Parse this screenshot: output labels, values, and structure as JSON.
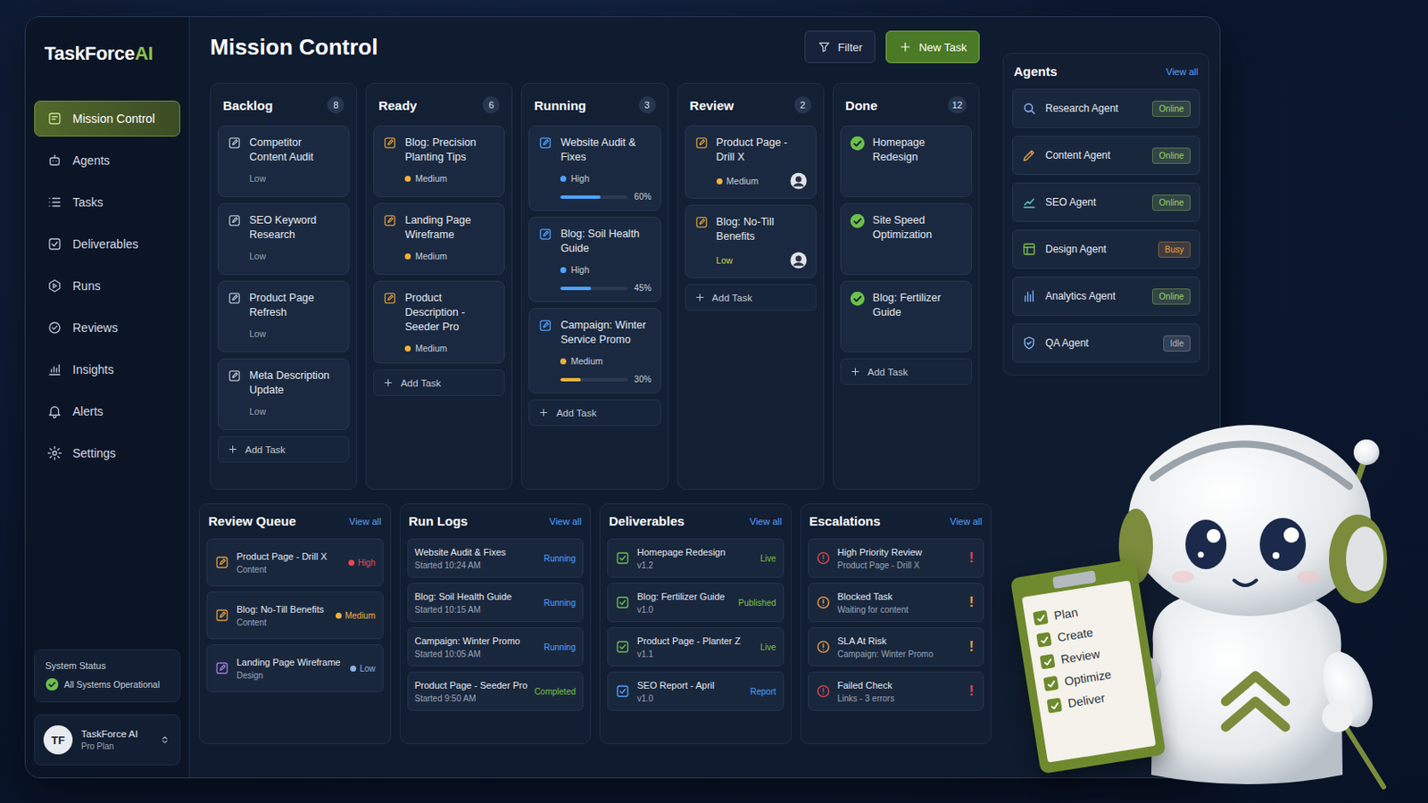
{
  "brand": {
    "name": "TaskForce",
    "accent": "AI"
  },
  "sidebar": {
    "items": [
      {
        "label": "Mission Control",
        "selected": true
      },
      {
        "label": "Agents",
        "selected": false
      },
      {
        "label": "Tasks",
        "selected": false
      },
      {
        "label": "Deliverables",
        "selected": false
      },
      {
        "label": "Runs",
        "selected": false
      },
      {
        "label": "Reviews",
        "selected": false
      },
      {
        "label": "Insights",
        "selected": false
      },
      {
        "label": "Alerts",
        "selected": false
      },
      {
        "label": "Settings",
        "selected": false
      }
    ]
  },
  "system_status": {
    "title": "System Status",
    "message": "All Systems Operational",
    "ok": true
  },
  "user": {
    "initials": "TF",
    "name": "TaskForce AI",
    "plan": "Pro Plan"
  },
  "header": {
    "title": "Mission Control",
    "buttons": [
      {
        "label": "Filter",
        "kind": "secondary"
      },
      {
        "label": "New Task",
        "kind": "primary"
      }
    ]
  },
  "board": {
    "columns": [
      {
        "title": "Backlog",
        "count": "8",
        "color": "#b9c3d2",
        "add_label": "Add Task",
        "cards": [
          {
            "kind": "task",
            "title": "Competitor Content Audit",
            "priority": {
              "label": "Low",
              "dot": false,
              "color": "#9aa3b2"
            }
          },
          {
            "kind": "task",
            "title": "SEO Keyword Research",
            "priority": {
              "label": "Low",
              "dot": false,
              "color": "#9aa3b2"
            }
          },
          {
            "kind": "task",
            "title": "Product Page Refresh",
            "priority": {
              "label": "Low",
              "dot": false,
              "color": "#9aa3b2"
            }
          },
          {
            "kind": "task",
            "title": "Meta Description Update",
            "priority": {
              "label": "Low",
              "dot": false,
              "color": "#9aa3b2"
            }
          }
        ]
      },
      {
        "title": "Ready",
        "count": "6",
        "color": "#d99a3c",
        "add_label": "Add Task",
        "cards": [
          {
            "kind": "task",
            "title": "Blog: Precision Planting Tips",
            "priority": {
              "label": "Medium",
              "dot": true,
              "color": "#f0b13a"
            }
          },
          {
            "kind": "task",
            "title": "Landing Page Wireframe",
            "priority": {
              "label": "Medium",
              "dot": true,
              "color": "#f0b13a"
            }
          },
          {
            "kind": "task",
            "title": "Product Description - Seeder Pro",
            "priority": {
              "label": "Medium",
              "dot": true,
              "color": "#f0b13a"
            }
          }
        ]
      },
      {
        "title": "Running",
        "count": "3",
        "color": "#4da3ff",
        "add_label": "Add Task",
        "cards": [
          {
            "kind": "progress",
            "title": "Website Audit & Fixes",
            "priority": {
              "label": "High",
              "dot": true,
              "color": "#4da3ff"
            },
            "level": 0.6,
            "reading": "60%"
          },
          {
            "kind": "progress",
            "title": "Blog: Soil Health Guide",
            "priority": {
              "label": "High",
              "dot": true,
              "color": "#4da3ff"
            },
            "level": 0.45,
            "reading": "45%"
          },
          {
            "kind": "progress",
            "title": "Campaign: Winter Service Promo",
            "priority": {
              "label": "Medium",
              "dot": true,
              "color": "#f0b13a"
            },
            "level": 0.3,
            "reading": "30%"
          }
        ]
      },
      {
        "title": "Review",
        "count": "2",
        "color": "#d99a3c",
        "add_label": "Add Task",
        "cards": [
          {
            "kind": "review",
            "title": "Product Page - Drill X",
            "priority": {
              "label": "Medium",
              "dot": true,
              "color": "#f0b13a"
            }
          },
          {
            "kind": "review",
            "title": "Blog: No-Till Benefits",
            "priority": {
              "label": "Low",
              "dot": false,
              "color": "#c8d44a"
            }
          }
        ]
      },
      {
        "title": "Done",
        "count": "12",
        "color": "#6cc04a",
        "add_label": "Add Task",
        "cards": [
          {
            "kind": "done",
            "title": "Homepage Redesign"
          },
          {
            "kind": "done",
            "title": "Site Speed Optimization"
          },
          {
            "kind": "done",
            "title": "Blog: Fertilizer Guide"
          }
        ]
      }
    ]
  },
  "agents": {
    "title": "Agents",
    "view_all": "View all",
    "items": [
      {
        "name": "Research Agent",
        "status": "Online",
        "color": "#9fd36a"
      },
      {
        "name": "Content Agent",
        "status": "Online",
        "color": "#9fd36a"
      },
      {
        "name": "SEO Agent",
        "status": "Online",
        "color": "#9fd36a"
      },
      {
        "name": "Design Agent",
        "status": "Busy",
        "color": "#f0a040"
      },
      {
        "name": "Analytics Agent",
        "status": "Online",
        "color": "#9fd36a"
      },
      {
        "name": "QA Agent",
        "status": "Idle",
        "color": "#aab4c3"
      }
    ]
  },
  "panels": {
    "review_queue": {
      "title": "Review Queue",
      "view_all": "View all",
      "items": [
        {
          "title": "Product Page - Drill X",
          "subtitle": "Content",
          "priority": "High",
          "color": "#e5484d",
          "icon_color": "#d99a3c"
        },
        {
          "title": "Blog: No-Till Benefits",
          "subtitle": "Content",
          "priority": "Medium",
          "color": "#f0b13a",
          "icon_color": "#d99a3c"
        },
        {
          "title": "Landing Page Wireframe",
          "subtitle": "Design",
          "priority": "Low",
          "color": "#8fb0e0",
          "icon_color": "#9a7ae0"
        }
      ]
    },
    "run_logs": {
      "title": "Run Logs",
      "view_all": "View all",
      "items": [
        {
          "title": "Website Audit & Fixes",
          "subtitle": "Started 10:24 AM",
          "status": "Running",
          "color": "#4da3ff"
        },
        {
          "title": "Blog: Soil Health Guide",
          "subtitle": "Started 10:15 AM",
          "status": "Running",
          "color": "#4da3ff"
        },
        {
          "title": "Campaign: Winter Promo",
          "subtitle": "Started 10:05 AM",
          "status": "Running",
          "color": "#4da3ff"
        },
        {
          "title": "Product Page - Seeder Pro",
          "subtitle": "Started 9:50 AM",
          "status": "Completed",
          "color": "#7cc044"
        }
      ]
    },
    "deliverables": {
      "title": "Deliverables",
      "view_all": "View all",
      "items": [
        {
          "title": "Homepage Redesign",
          "subtitle": "v1.2",
          "status": "Live",
          "color": "#7cc044",
          "icon_color": "#6cc04a"
        },
        {
          "title": "Blog: Fertilizer Guide",
          "subtitle": "v1.0",
          "status": "Published",
          "color": "#7cc044",
          "icon_color": "#6cc04a"
        },
        {
          "title": "Product Page - Planter Z",
          "subtitle": "v1.1",
          "status": "Live",
          "color": "#7cc044",
          "icon_color": "#6cc04a"
        },
        {
          "title": "SEO Report - April",
          "subtitle": "v1.0",
          "status": "Report",
          "color": "#4da3ff",
          "icon_color": "#4da3ff"
        }
      ]
    },
    "escalations": {
      "title": "Escalations",
      "view_all": "View all",
      "items": [
        {
          "title": "High Priority Review",
          "subtitle": "Product Page - Drill X",
          "flag": "!",
          "color": "#e5484d"
        },
        {
          "title": "Blocked Task",
          "subtitle": "Waiting for content",
          "flag": "!",
          "color": "#f0a040"
        },
        {
          "title": "SLA At Risk",
          "subtitle": "Campaign: Winter Promo",
          "flag": "!",
          "color": "#f0a040"
        },
        {
          "title": "Failed Check",
          "subtitle": "Links - 3 errors",
          "flag": "!",
          "color": "#e5484d"
        }
      ]
    }
  },
  "mascot": {
    "checklist": [
      {
        "label": "Plan",
        "checked": true
      },
      {
        "label": "Create",
        "checked": true
      },
      {
        "label": "Review",
        "checked": true
      },
      {
        "label": "Optimize",
        "checked": true
      },
      {
        "label": "Deliver",
        "checked": true
      }
    ]
  }
}
